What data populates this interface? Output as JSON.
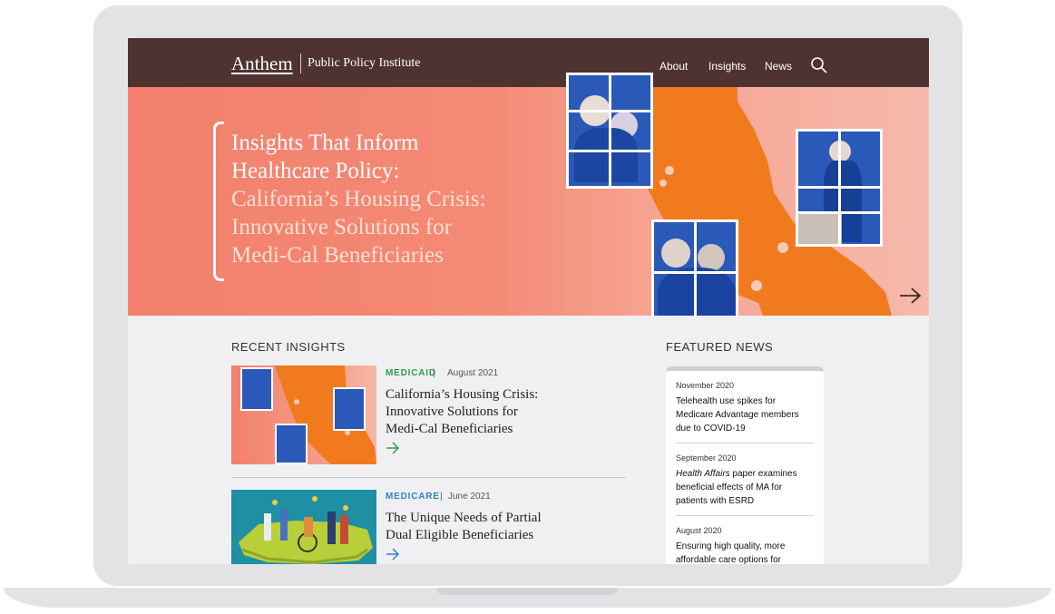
{
  "header": {
    "logo": "Anthem",
    "subtitle": "Public Policy Institute",
    "nav": [
      "About",
      "Insights",
      "News"
    ]
  },
  "hero": {
    "title_lines": [
      "Insights That Inform",
      "Healthcare Policy:"
    ],
    "subtitle_lines": [
      "California’s Housing Crisis:",
      "Innovative Solutions for",
      "Medi-Cal Beneficiaries"
    ]
  },
  "recent": {
    "label": "RECENT INSIGHTS",
    "cards": [
      {
        "tag": "MEDICAID",
        "tag_color": "#2e9c4b",
        "date": "August 2021",
        "title_lines": [
          "California’s Housing Crisis:",
          "Innovative Solutions for",
          "Medi-Cal Beneficiaries"
        ]
      },
      {
        "tag": "MEDICARE",
        "tag_color": "#2a83c9",
        "date": "June 2021",
        "title_lines": [
          "The Unique Needs of Partial",
          "Dual Eligible Beneficiaries"
        ]
      }
    ]
  },
  "featured": {
    "label": "FEATURED NEWS",
    "items": [
      {
        "date": "November 2020",
        "title_lines": [
          "Telehealth use spikes for",
          "Medicare Advantage members",
          "due to COVID-19"
        ]
      },
      {
        "date": "September 2020",
        "title_italic": "Health Affairs",
        "title_lines": [
          " paper examines",
          "beneficial effects of MA for",
          "patients with ESRD"
        ]
      },
      {
        "date": "August 2020",
        "title_lines": [
          "Ensuring high quality, more",
          "affordable care options for"
        ]
      }
    ]
  },
  "colors": {
    "nav_bg": "#4f3330",
    "hero_coral": "#f2806c",
    "california_orange": "#f07a1d",
    "photo_blue": "#2b59b8",
    "medicaid_green": "#2e9c4b",
    "medicare_blue": "#2a83c9"
  },
  "icons": [
    "search-icon",
    "arrow-right-icon"
  ]
}
